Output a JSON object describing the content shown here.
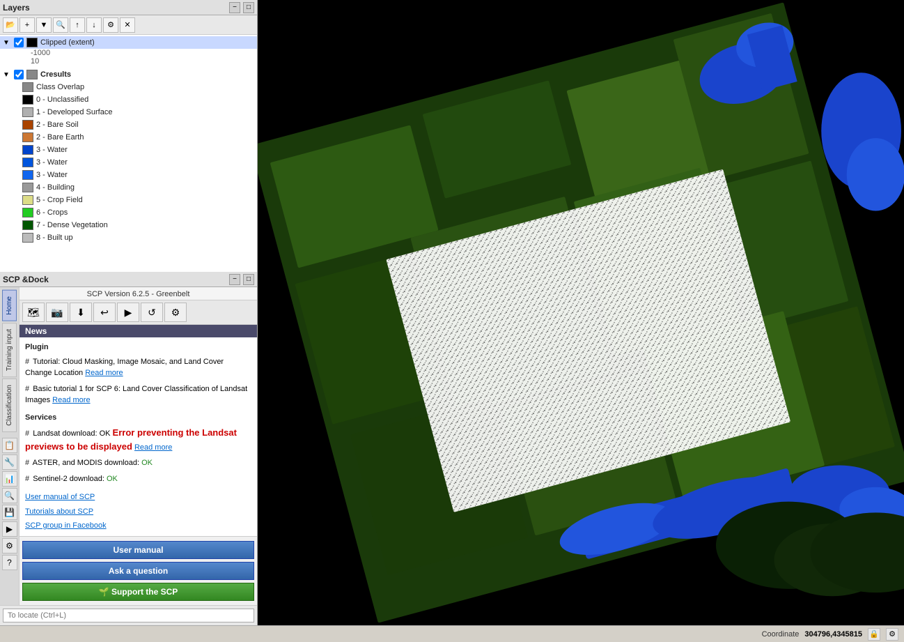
{
  "layers_panel": {
    "title": "Layers",
    "controls": [
      "−",
      "□"
    ],
    "toolbar_icons": [
      "⊞",
      "⊟",
      "↑",
      "↓",
      "⚙",
      "🔍",
      "✕"
    ],
    "clipped_layer": {
      "name": "Clipped (extent)",
      "value_minus1000": "-1000",
      "value_10": "10",
      "checked": true
    },
    "cresults_layer": {
      "name": "Cresults",
      "checked": true,
      "items": [
        {
          "label": "Class Overlap",
          "color": "#888888"
        },
        {
          "label": "0 - Unclassified",
          "color": "#000000"
        },
        {
          "label": "1 - Developed Surface",
          "color": "#aaaaaa"
        },
        {
          "label": "2 - Bare Soil",
          "color": "#aa4400"
        },
        {
          "label": "2 - Bare Earth",
          "color": "#cc6622"
        },
        {
          "label": "3 - Water",
          "color": "#0044cc"
        },
        {
          "label": "3 - Water",
          "color": "#0055dd"
        },
        {
          "label": "3 - Water",
          "color": "#1166ee"
        },
        {
          "label": "4 - Building",
          "color": "#999999"
        },
        {
          "label": "5 - Crop Field",
          "color": "#dddd88"
        },
        {
          "label": "6 - Crops",
          "color": "#22cc22"
        },
        {
          "label": "7 - Dense Vegetation",
          "color": "#005500"
        },
        {
          "label": "8 - Built up",
          "color": "#bbbbbb"
        }
      ]
    }
  },
  "scp_panel": {
    "title": "SCP &Dock",
    "controls": [
      "−",
      "□"
    ],
    "version_label": "SCP Version 6.2.5 - Greenbelt",
    "toolbar_icons": [
      "🗺",
      "📷",
      "⬇",
      "↩",
      "▶",
      "↺",
      "⚙"
    ],
    "tabs": [
      "Home",
      "Training input",
      "Classification"
    ],
    "active_tab": "Home",
    "side_icons": [
      "📋",
      "🔧",
      "📊",
      "🔍",
      "💾",
      "▶",
      "⚙",
      "?"
    ],
    "news": {
      "header": "News",
      "plugin_title": "Plugin",
      "items": [
        {
          "hash": "#",
          "text": "Tutorial: Cloud Masking, Image Mosaic, and Land Cover Change Location",
          "link_text": "Read more"
        },
        {
          "hash": "#",
          "text": "Basic tutorial 1 for SCP 6: Land Cover Classification of Landsat Images",
          "link_text": "Read more"
        }
      ],
      "services_title": "Services",
      "service_items": [
        {
          "hash": "#",
          "text": "Landsat download: OK",
          "error": "Error preventing the Landsat previews to be displayed",
          "link_text": "Read more"
        },
        {
          "hash": "#",
          "text": "ASTER, and MODIS download: OK"
        },
        {
          "hash": "#",
          "text": "Sentinel-2 download: OK"
        }
      ],
      "links": [
        "User manual of SCP",
        "Tutorials about SCP",
        "SCP group in Facebook"
      ]
    },
    "buttons": {
      "user_manual": "User manual",
      "ask_question": "Ask a question",
      "support": "🌱 Support the SCP"
    }
  },
  "status_bar": {
    "coordinate_label": "Coordinate",
    "coordinate_value": "304796,4345815"
  },
  "search": {
    "placeholder": "To locate (Ctrl+L)"
  }
}
